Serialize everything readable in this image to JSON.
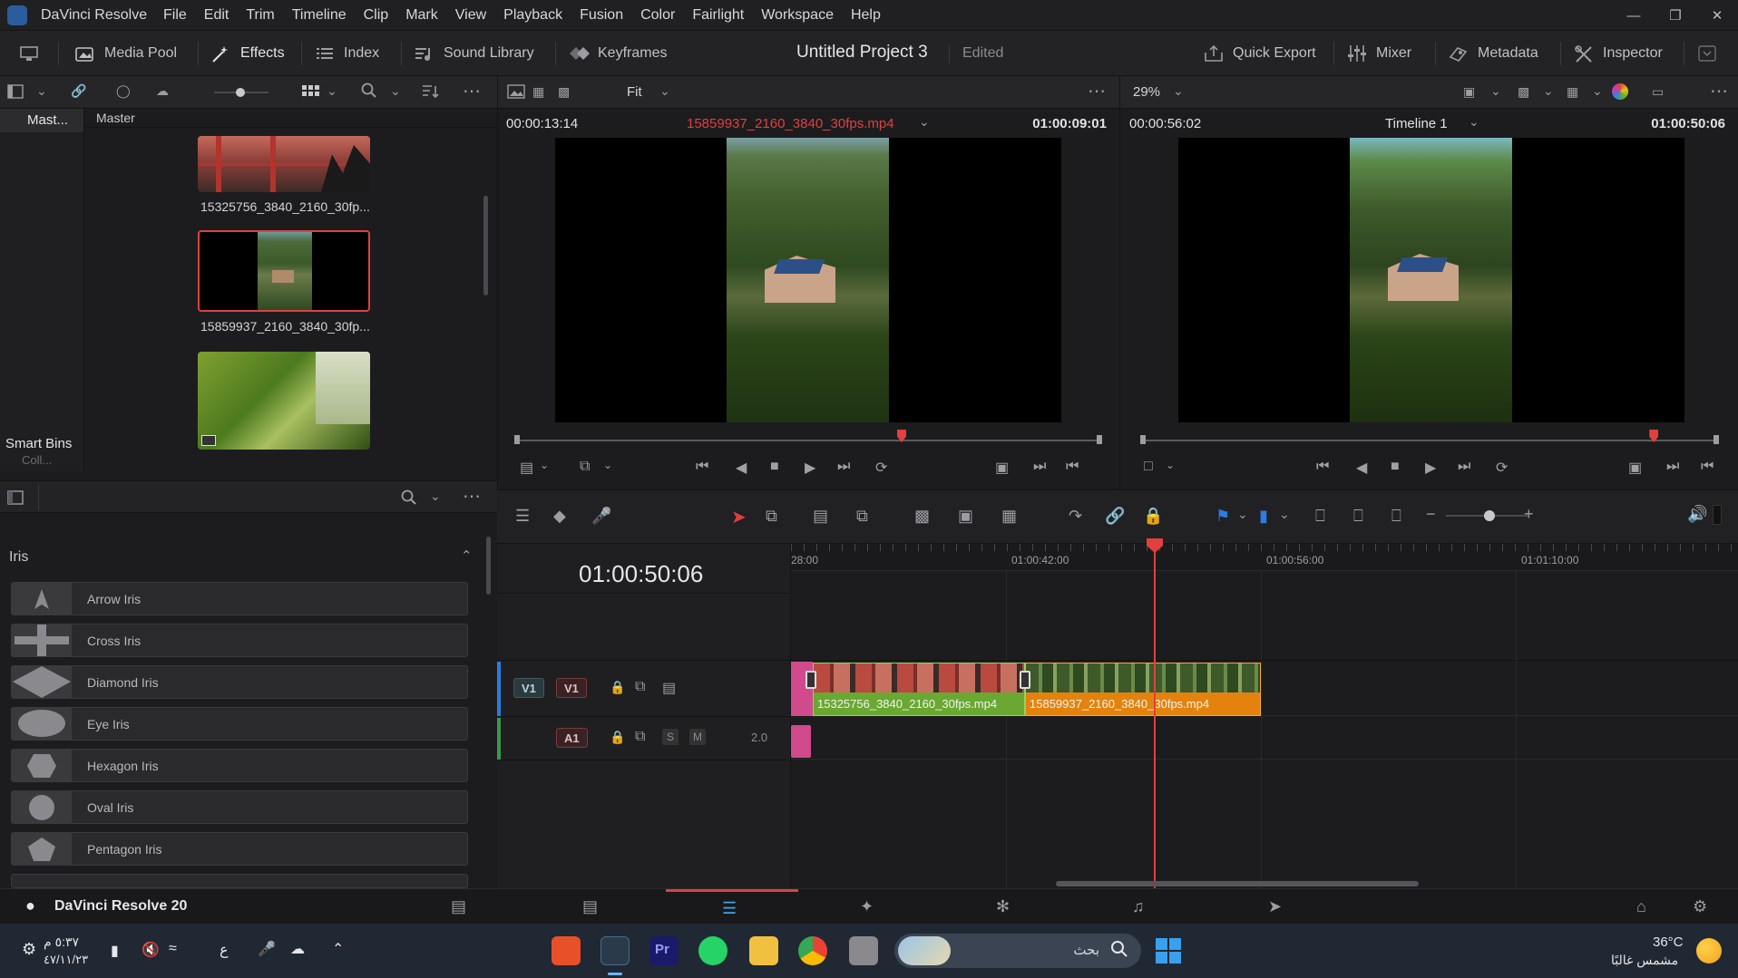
{
  "app": {
    "name": "DaVinci Resolve",
    "menus": [
      "File",
      "Edit",
      "Trim",
      "Timeline",
      "Clip",
      "Mark",
      "View",
      "Playback",
      "Fusion",
      "Color",
      "Fairlight",
      "Workspace",
      "Help"
    ]
  },
  "toolbar": {
    "media_pool": "Media Pool",
    "effects": "Effects",
    "index": "Index",
    "sound_library": "Sound Library",
    "keyframes": "Keyframes",
    "project_title": "Untitled Project 3",
    "project_status": "Edited",
    "quick_export": "Quick Export",
    "mixer": "Mixer",
    "metadata": "Metadata",
    "inspector": "Inspector"
  },
  "bins": {
    "master_short": "Mast...",
    "master": "Master",
    "smart_bins": "Smart Bins",
    "collections": "Coll..."
  },
  "media_pool": {
    "clips": [
      {
        "name": "15325756_3840_2160_30fp..."
      },
      {
        "name": "15859937_2160_3840_30fp..."
      },
      {
        "name": ""
      }
    ]
  },
  "effects": {
    "category": "Iris",
    "items": [
      "Arrow Iris",
      "Cross Iris",
      "Diamond Iris",
      "Eye Iris",
      "Hexagon Iris",
      "Oval Iris",
      "Pentagon Iris"
    ]
  },
  "source_viewer": {
    "zoom": "Fit",
    "timecode_left": "00:00:13:14",
    "clip_name": "15859937_2160_3840_30fps.mp4",
    "timecode_right": "01:00:09:01",
    "playhead_fraction": 0.66
  },
  "timeline_viewer": {
    "zoom": "29%",
    "timecode_left": "00:00:56:02",
    "timeline_name": "Timeline 1",
    "timecode_right": "01:00:50:06",
    "playhead_fraction": 0.89
  },
  "timeline": {
    "current_timecode": "01:00:50:06",
    "ruler": [
      "28:00",
      "01:00:42:00",
      "01:00:56:00",
      "01:01:10:00"
    ],
    "tracks": {
      "v1_src": "V1",
      "v1": "V1",
      "a1": "A1",
      "a1_solo": "S",
      "a1_mute": "M",
      "a1_level": "2.0"
    },
    "clips": [
      {
        "name": "15325756_3840_2160_30fps.mp4",
        "color": "#6aa832"
      },
      {
        "name": "15859937_2160_3840_30fps.mp4",
        "color": "#e3830d"
      }
    ]
  },
  "pagebar": {
    "product": "DaVinci Resolve 20"
  },
  "taskbar": {
    "time": "٥:٣٧ م",
    "date": "٤٧/١١/٢٣",
    "lang": "ع",
    "search_placeholder": "بحث",
    "weather_temp": "36°C",
    "weather_text": "مشمس غالبًا"
  },
  "colors": {
    "accent_red": "#e0403e",
    "clip_green": "#6aa832",
    "clip_orange": "#e3830d",
    "pink": "#d04a8c"
  }
}
